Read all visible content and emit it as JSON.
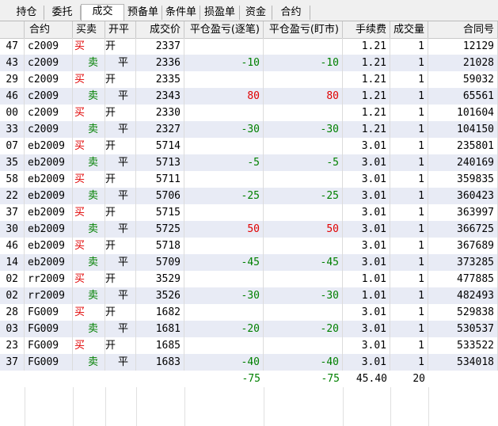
{
  "tabs": [
    {
      "label": "持仓",
      "active": false
    },
    {
      "label": "委托",
      "active": false
    },
    {
      "label": "成交",
      "active": true
    },
    {
      "label": "预备单",
      "active": false
    },
    {
      "label": "条件单",
      "active": false
    },
    {
      "label": "损盈单",
      "active": false
    },
    {
      "label": "资金",
      "active": false
    },
    {
      "label": "合约",
      "active": false
    }
  ],
  "columns": [
    "合约",
    "买卖",
    "开平",
    "成交价",
    "平仓盈亏(逐笔)",
    "平仓盈亏(盯市)",
    "手续费",
    "成交量",
    "合同号"
  ],
  "rows": [
    {
      "id": "47",
      "contract": "c2009",
      "side": "买",
      "oc": "开",
      "price": "2337",
      "pnl_trade": "",
      "pnl_mark": "",
      "fee": "1.21",
      "qty": "1",
      "order": "12129"
    },
    {
      "id": "43",
      "contract": "c2009",
      "side": "卖",
      "oc": "平",
      "price": "2336",
      "pnl_trade": "-10",
      "pnl_mark": "-10",
      "fee": "1.21",
      "qty": "1",
      "order": "21028"
    },
    {
      "id": "29",
      "contract": "c2009",
      "side": "买",
      "oc": "开",
      "price": "2335",
      "pnl_trade": "",
      "pnl_mark": "",
      "fee": "1.21",
      "qty": "1",
      "order": "59032"
    },
    {
      "id": "46",
      "contract": "c2009",
      "side": "卖",
      "oc": "平",
      "price": "2343",
      "pnl_trade": "80",
      "pnl_mark": "80",
      "fee": "1.21",
      "qty": "1",
      "order": "65561"
    },
    {
      "id": "00",
      "contract": "c2009",
      "side": "买",
      "oc": "开",
      "price": "2330",
      "pnl_trade": "",
      "pnl_mark": "",
      "fee": "1.21",
      "qty": "1",
      "order": "101604"
    },
    {
      "id": "33",
      "contract": "c2009",
      "side": "卖",
      "oc": "平",
      "price": "2327",
      "pnl_trade": "-30",
      "pnl_mark": "-30",
      "fee": "1.21",
      "qty": "1",
      "order": "104150"
    },
    {
      "id": "07",
      "contract": "eb2009",
      "side": "买",
      "oc": "开",
      "price": "5714",
      "pnl_trade": "",
      "pnl_mark": "",
      "fee": "3.01",
      "qty": "1",
      "order": "235801"
    },
    {
      "id": "35",
      "contract": "eb2009",
      "side": "卖",
      "oc": "平",
      "price": "5713",
      "pnl_trade": "-5",
      "pnl_mark": "-5",
      "fee": "3.01",
      "qty": "1",
      "order": "240169"
    },
    {
      "id": "58",
      "contract": "eb2009",
      "side": "买",
      "oc": "开",
      "price": "5711",
      "pnl_trade": "",
      "pnl_mark": "",
      "fee": "3.01",
      "qty": "1",
      "order": "359835"
    },
    {
      "id": "22",
      "contract": "eb2009",
      "side": "卖",
      "oc": "平",
      "price": "5706",
      "pnl_trade": "-25",
      "pnl_mark": "-25",
      "fee": "3.01",
      "qty": "1",
      "order": "360423"
    },
    {
      "id": "37",
      "contract": "eb2009",
      "side": "买",
      "oc": "开",
      "price": "5715",
      "pnl_trade": "",
      "pnl_mark": "",
      "fee": "3.01",
      "qty": "1",
      "order": "363997"
    },
    {
      "id": "30",
      "contract": "eb2009",
      "side": "卖",
      "oc": "平",
      "price": "5725",
      "pnl_trade": "50",
      "pnl_mark": "50",
      "fee": "3.01",
      "qty": "1",
      "order": "366725"
    },
    {
      "id": "46",
      "contract": "eb2009",
      "side": "买",
      "oc": "开",
      "price": "5718",
      "pnl_trade": "",
      "pnl_mark": "",
      "fee": "3.01",
      "qty": "1",
      "order": "367689"
    },
    {
      "id": "14",
      "contract": "eb2009",
      "side": "卖",
      "oc": "平",
      "price": "5709",
      "pnl_trade": "-45",
      "pnl_mark": "-45",
      "fee": "3.01",
      "qty": "1",
      "order": "373285"
    },
    {
      "id": "02",
      "contract": "rr2009",
      "side": "买",
      "oc": "开",
      "price": "3529",
      "pnl_trade": "",
      "pnl_mark": "",
      "fee": "1.01",
      "qty": "1",
      "order": "477885"
    },
    {
      "id": "02",
      "contract": "rr2009",
      "side": "卖",
      "oc": "平",
      "price": "3526",
      "pnl_trade": "-30",
      "pnl_mark": "-30",
      "fee": "1.01",
      "qty": "1",
      "order": "482493"
    },
    {
      "id": "28",
      "contract": "FG009",
      "side": "买",
      "oc": "开",
      "price": "1682",
      "pnl_trade": "",
      "pnl_mark": "",
      "fee": "3.01",
      "qty": "1",
      "order": "529838"
    },
    {
      "id": "03",
      "contract": "FG009",
      "side": "卖",
      "oc": "平",
      "price": "1681",
      "pnl_trade": "-20",
      "pnl_mark": "-20",
      "fee": "3.01",
      "qty": "1",
      "order": "530537"
    },
    {
      "id": "23",
      "contract": "FG009",
      "side": "买",
      "oc": "开",
      "price": "1685",
      "pnl_trade": "",
      "pnl_mark": "",
      "fee": "3.01",
      "qty": "1",
      "order": "533522"
    },
    {
      "id": "37",
      "contract": "FG009",
      "side": "卖",
      "oc": "平",
      "price": "1683",
      "pnl_trade": "-40",
      "pnl_mark": "-40",
      "fee": "3.01",
      "qty": "1",
      "order": "534018"
    }
  ],
  "totals": {
    "pnl_trade": "-75",
    "pnl_mark": "-75",
    "fee": "45.40",
    "qty": "20"
  },
  "colors": {
    "buy": "#e00000",
    "sell": "#008000",
    "positive": "#e00000",
    "negative": "#008000",
    "row_alt": "#e8ebf5"
  }
}
